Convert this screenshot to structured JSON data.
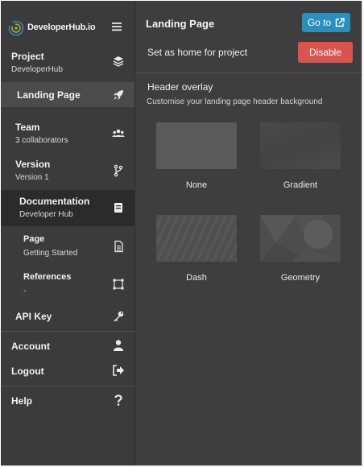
{
  "brand": {
    "name": "DeveloperHub.io"
  },
  "sidebar": {
    "project": {
      "label": "Project",
      "sub": "DeveloperHub"
    },
    "landing": {
      "label": "Landing Page"
    },
    "team": {
      "label": "Team",
      "sub": "3 collaborators"
    },
    "version": {
      "label": "Version",
      "sub": "Version 1"
    },
    "documentation": {
      "label": "Documentation",
      "sub": "Developer Hub"
    },
    "page": {
      "label": "Page",
      "sub": "Getting Started"
    },
    "references": {
      "label": "References",
      "sub": "-"
    },
    "api_key": {
      "label": "API Key"
    },
    "account": {
      "label": "Account"
    },
    "logout": {
      "label": "Logout"
    },
    "help": {
      "label": "Help"
    }
  },
  "main": {
    "title": "Landing Page",
    "goto_label": "Go to",
    "home_label": "Set as home for project",
    "disable_label": "Disable",
    "overlay_title": "Header overlay",
    "overlay_desc": "Customise your landing page header background",
    "options": [
      {
        "label": "None"
      },
      {
        "label": "Gradient"
      },
      {
        "label": "Dash"
      },
      {
        "label": "Geometry"
      }
    ]
  },
  "colors": {
    "accent_blue": "#2a8fbd",
    "danger_red": "#d9534f",
    "sidebar_bg": "#3b3b3b",
    "main_bg": "#3e3e3e"
  }
}
